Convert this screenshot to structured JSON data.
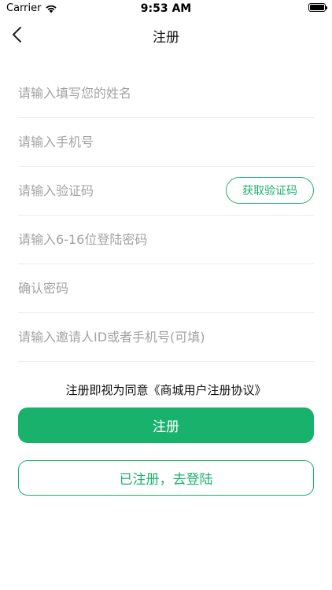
{
  "status_bar": {
    "carrier": "Carrier",
    "time": "9:53 AM",
    "wifi_icon": "wifi-icon",
    "battery_icon": "battery-icon"
  },
  "nav": {
    "title": "注册",
    "back_icon": "chevron-left-icon"
  },
  "form": {
    "name_placeholder": "请输入填写您的姓名",
    "phone_placeholder": "请输入手机号",
    "code_placeholder": "请输入验证码",
    "get_code_label": "获取验证码",
    "password_placeholder": "请输入6-16位登陆密码",
    "confirm_placeholder": "确认密码",
    "invite_placeholder": "请输入邀请人ID或者手机号(可填)"
  },
  "agreement": {
    "prefix": "注册即视为同意",
    "link": "《商城用户注册协议》"
  },
  "buttons": {
    "register": "注册",
    "login": "已注册，去登陆"
  },
  "colors": {
    "accent": "#19b26d"
  }
}
